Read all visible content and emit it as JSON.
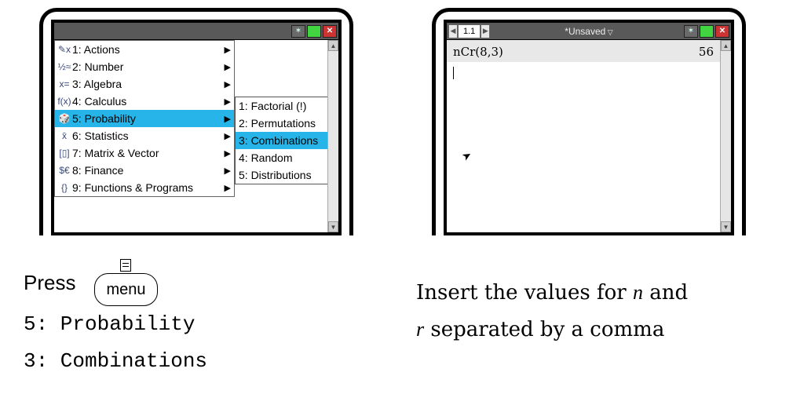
{
  "left_calc": {
    "main_menu": [
      {
        "icon": "✎x",
        "label": "1: Actions"
      },
      {
        "icon": "½≈",
        "label": "2: Number"
      },
      {
        "icon": "x=",
        "label": "3: Algebra"
      },
      {
        "icon": "f(x)",
        "label": "4: Calculus"
      },
      {
        "icon": "🎲",
        "label": "5: Probability",
        "highlight": true
      },
      {
        "icon": "x̄",
        "label": "6: Statistics"
      },
      {
        "icon": "[▯]",
        "label": "7: Matrix & Vector"
      },
      {
        "icon": "$€",
        "label": "8: Finance"
      },
      {
        "icon": "{}",
        "label": "9: Functions & Programs"
      }
    ],
    "sub_menu": [
      {
        "label": "1: Factorial (!)"
      },
      {
        "label": "2: Permutations"
      },
      {
        "label": "3: Combinations",
        "highlight": true,
        "arrow": true
      },
      {
        "label": "4: Random",
        "arrow": true
      },
      {
        "label": "5: Distributions",
        "arrow": true
      }
    ]
  },
  "right_calc": {
    "tab": "1.1",
    "title": "*Unsaved",
    "expr": "nCr(8,3)",
    "result": "56"
  },
  "caption_left": {
    "press": "Press",
    "menu_key": "menu",
    "line1": "5: Probability",
    "line2": "3: Combinations"
  },
  "caption_right": {
    "t1": "Insert the values for ",
    "var_n": "n",
    "t2": " and",
    "var_r": "r",
    "t3": " separated by a comma"
  }
}
